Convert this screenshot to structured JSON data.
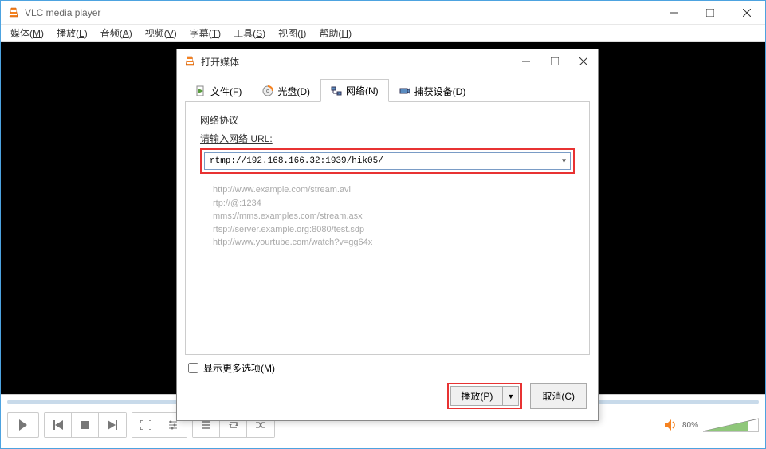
{
  "main_window": {
    "title": "VLC media player",
    "menu": [
      {
        "label": "媒体",
        "accel": "M"
      },
      {
        "label": "播放",
        "accel": "L"
      },
      {
        "label": "音频",
        "accel": "A"
      },
      {
        "label": "视频",
        "accel": "V"
      },
      {
        "label": "字幕",
        "accel": "T"
      },
      {
        "label": "工具",
        "accel": "S"
      },
      {
        "label": "视图",
        "accel": "I"
      },
      {
        "label": "帮助",
        "accel": "H"
      }
    ],
    "volume_percent": "80%"
  },
  "dialog": {
    "title": "打开媒体",
    "tabs": {
      "file": "文件(F)",
      "disc": "光盘(D)",
      "network": "网络(N)",
      "capture": "捕获设备(D)"
    },
    "network": {
      "section_label": "网络协议",
      "url_label": "请输入网络 URL:",
      "url_value": "rtmp://192.168.166.32:1939/hik05/",
      "examples": [
        "http://www.example.com/stream.avi",
        "rtp://@:1234",
        "mms://mms.examples.com/stream.asx",
        "rtsp://server.example.org:8080/test.sdp",
        "http://www.yourtube.com/watch?v=gg64x"
      ]
    },
    "more_options_label": "显示更多选项(M)",
    "buttons": {
      "play": "播放(P)",
      "cancel": "取消(C)"
    }
  }
}
